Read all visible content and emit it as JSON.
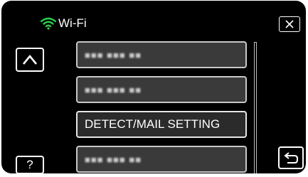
{
  "header": {
    "title": "Wi-Fi",
    "wifi_icon": "wifi-icon",
    "accent_color": "#2bd24a"
  },
  "controls": {
    "close_icon": "close-icon",
    "up_icon": "chevron-up-icon",
    "help_label": "?",
    "back_icon": "back-arrow-icon"
  },
  "list": {
    "items": [
      {
        "label": "■■■ ■■■ ■■",
        "masked": true
      },
      {
        "label": "■■■ ■■■ ■■",
        "masked": true
      },
      {
        "label": "DETECT/MAIL SETTING",
        "masked": false
      },
      {
        "label": "■■■ ■■■ ■■",
        "masked": true
      }
    ]
  }
}
